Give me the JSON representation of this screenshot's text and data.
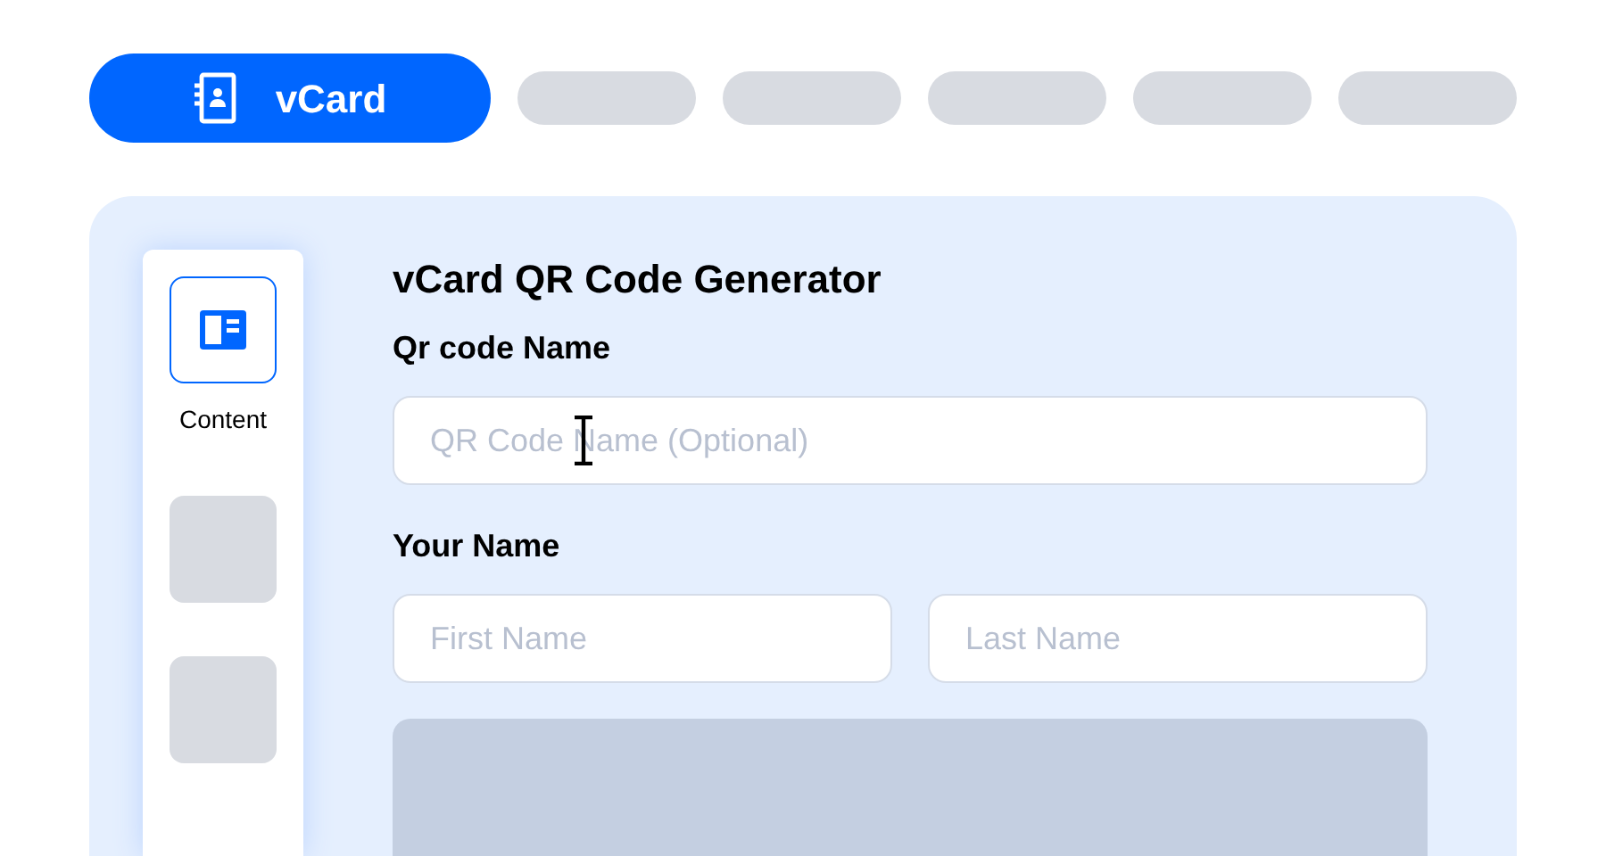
{
  "tabs": [
    {
      "label": "vCard",
      "selected": true
    }
  ],
  "sidebar": {
    "items": [
      {
        "label": "Content",
        "selected": true
      }
    ]
  },
  "form": {
    "title": "vCard QR Code Generator",
    "qr_name": {
      "label": "Qr code Name",
      "placeholder": "QR Code Name (Optional)"
    },
    "your_name": {
      "label": "Your Name",
      "fields": [
        {
          "placeholder": "First Name"
        },
        {
          "placeholder": "Last Name"
        }
      ]
    }
  }
}
